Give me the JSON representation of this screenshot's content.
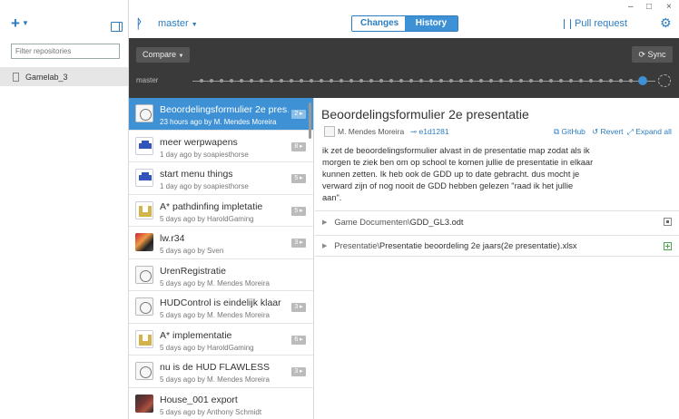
{
  "sidebar": {
    "add_label": "+",
    "filter_placeholder": "Filter repositories",
    "repos": [
      {
        "name": "Gamelab_3"
      }
    ]
  },
  "topbar": {
    "branch": "master",
    "tabs": [
      {
        "label": "Changes"
      },
      {
        "label": "History"
      }
    ],
    "pull_request": "Pull request",
    "window_controls": [
      "–",
      "□",
      "×"
    ]
  },
  "timeline": {
    "compare_label": "Compare",
    "sync_label": "Sync",
    "branch_label": "master"
  },
  "history": [
    {
      "title": "Beoordelingsformulier 2e pres…",
      "meta": "23 hours ago by M. Mendes Moreira",
      "badge": "2",
      "avatar": "sketch",
      "selected": true
    },
    {
      "title": "meer werpwapens",
      "meta": "1 day ago by soapiesthorse",
      "badge": "8",
      "avatar": "blue"
    },
    {
      "title": "start menu things",
      "meta": "1 day ago by soapiesthorse",
      "badge": "5",
      "avatar": "blue"
    },
    {
      "title": "A* pathdinfing impletatie",
      "meta": "5 days ago by HaroldGaming",
      "badge": "5",
      "avatar": "gold"
    },
    {
      "title": "lw.r34",
      "meta": "5 days ago by Sven",
      "badge": "3",
      "avatar": "photo"
    },
    {
      "title": "UrenRegistratie",
      "meta": "5 days ago by M. Mendes Moreira",
      "badge": "",
      "avatar": "sketch"
    },
    {
      "title": "HUDControl is eindelijk klaar",
      "meta": "5 days ago by M. Mendes Moreira",
      "badge": "3",
      "avatar": "sketch"
    },
    {
      "title": "A* implementatie",
      "meta": "5 days ago by HaroldGaming",
      "badge": "6",
      "avatar": "gold"
    },
    {
      "title": "nu is de HUD FLAWLESS",
      "meta": "5 days ago by M. Mendes Moreira",
      "badge": "3",
      "avatar": "sketch"
    },
    {
      "title": "House_001 export",
      "meta": "5 days ago by Anthony Schmidt",
      "badge": "",
      "avatar": "photo2"
    }
  ],
  "detail": {
    "title": "Beoordelingsformulier 2e presentatie",
    "author": "M. Mendes Moreira",
    "sha": "e1d1281",
    "github_link": "GitHub",
    "revert_link": "Revert",
    "expand_link": "Expand all",
    "message": "ik zet de beoordelingsformulier alvast in de presentatie map zodat als ik morgen te ziek ben om op school te komen jullie de presentatie in elkaar kunnen zetten. Ik heb ook de GDD up to date gebracht. dus mocht je verward zijn of nog nooit de GDD hebben gelezen \"raad ik het jullie aan\".",
    "files": [
      {
        "dir": "Game Documenten\\",
        "name": "GDD_GL3.odt",
        "status": "modified"
      },
      {
        "dir": "Presentatie\\",
        "name": "Presentatie beoordeling 2e jaars(2e presentatie).xlsx",
        "status": "added"
      }
    ]
  }
}
